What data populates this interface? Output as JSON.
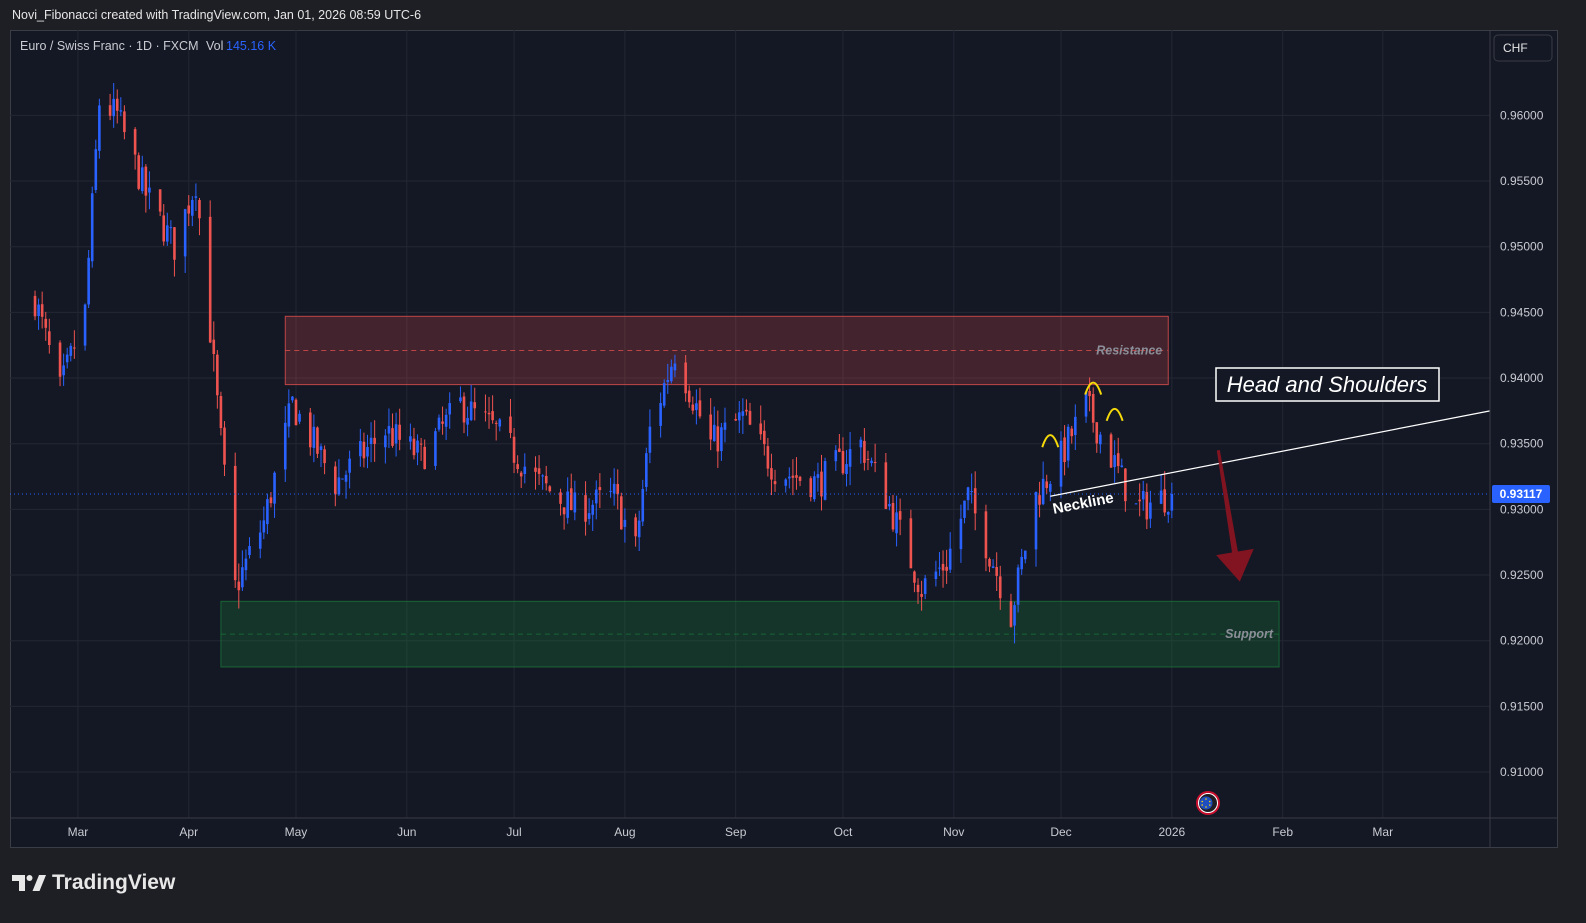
{
  "header": {
    "credit": "Novi_Fibonacci created with TradingView.com, Jan 01, 2026 08:59 UTC-6"
  },
  "legend": {
    "symbol": "Euro / Swiss Franc · 1D · FXCM",
    "vol_label": "Vol",
    "vol_value": "145.16 K"
  },
  "currency_button": "CHF",
  "footer": {
    "brand": "TradingView"
  },
  "colors": {
    "up": "#2962ff",
    "down": "#ef5350",
    "resistance_zone": "#ef5350",
    "support_zone": "#1b7a3a",
    "accent_label": "#2962ff",
    "pattern": "#f5d90a",
    "arrow": "#8e1320"
  },
  "chart_data": {
    "type": "candlestick",
    "symbol": "EURCHF",
    "timeframe": "1D",
    "y_axis": {
      "ticks": [
        "0.96000",
        "0.95500",
        "0.95000",
        "0.94500",
        "0.94000",
        "0.93500",
        "0.93000",
        "0.92500",
        "0.92000",
        "0.91500",
        "0.91000"
      ],
      "range": [
        0.9065,
        0.9665
      ]
    },
    "x_axis": {
      "ticks": [
        "Mar",
        "Apr",
        "May",
        "Jun",
        "Jul",
        "Aug",
        "Sep",
        "Oct",
        "Nov",
        "Dec",
        "2026",
        "Feb",
        "Mar"
      ]
    },
    "last_price": "0.93117",
    "price_path": [
      {
        "t": "2025-02-17",
        "close": 0.946
      },
      {
        "t": "2025-02-24",
        "close": 0.939
      },
      {
        "t": "2025-03-03",
        "close": 0.945
      },
      {
        "t": "2025-03-07",
        "close": 0.961
      },
      {
        "t": "2025-03-12",
        "close": 0.96
      },
      {
        "t": "2025-03-20",
        "close": 0.954
      },
      {
        "t": "2025-03-28",
        "close": 0.95
      },
      {
        "t": "2025-04-03",
        "close": 0.955
      },
      {
        "t": "2025-04-09",
        "close": 0.938
      },
      {
        "t": "2025-04-14",
        "close": 0.924
      },
      {
        "t": "2025-04-22",
        "close": 0.929
      },
      {
        "t": "2025-04-30",
        "close": 0.938
      },
      {
        "t": "2025-05-12",
        "close": 0.932
      },
      {
        "t": "2025-05-26",
        "close": 0.936
      },
      {
        "t": "2025-06-05",
        "close": 0.934
      },
      {
        "t": "2025-06-16",
        "close": 0.938
      },
      {
        "t": "2025-06-26",
        "close": 0.936
      },
      {
        "t": "2025-07-08",
        "close": 0.932
      },
      {
        "t": "2025-07-18",
        "close": 0.93
      },
      {
        "t": "2025-07-29",
        "close": 0.931
      },
      {
        "t": "2025-08-04",
        "close": 0.927
      },
      {
        "t": "2025-08-08",
        "close": 0.936
      },
      {
        "t": "2025-08-15",
        "close": 0.942
      },
      {
        "t": "2025-08-25",
        "close": 0.935
      },
      {
        "t": "2025-09-03",
        "close": 0.937
      },
      {
        "t": "2025-09-12",
        "close": 0.933
      },
      {
        "t": "2025-09-24",
        "close": 0.932
      },
      {
        "t": "2025-10-06",
        "close": 0.935
      },
      {
        "t": "2025-10-13",
        "close": 0.931
      },
      {
        "t": "2025-10-23",
        "close": 0.924
      },
      {
        "t": "2025-10-30",
        "close": 0.926
      },
      {
        "t": "2025-11-05",
        "close": 0.931
      },
      {
        "t": "2025-11-12",
        "close": 0.926
      },
      {
        "t": "2025-11-17",
        "close": 0.922
      },
      {
        "t": "2025-11-24",
        "close": 0.931
      },
      {
        "t": "2025-12-01",
        "close": 0.934
      },
      {
        "t": "2025-12-08",
        "close": 0.938
      },
      {
        "t": "2025-12-15",
        "close": 0.934
      },
      {
        "t": "2025-12-22",
        "close": 0.93
      },
      {
        "t": "2026-01-01",
        "close": 0.9312
      }
    ],
    "zones": [
      {
        "name": "Resistance",
        "from": "2025-04-28",
        "to": "2025-12-31",
        "low": 0.9395,
        "high": 0.9447
      },
      {
        "name": "Support",
        "from": "2025-04-10",
        "to": "2026-01-31",
        "low": 0.918,
        "high": 0.923
      }
    ],
    "annotations": [
      {
        "type": "label",
        "text": "Head and Shoulders"
      },
      {
        "type": "trendline",
        "text": "Neckline",
        "points": [
          {
            "t": "2025-11-28",
            "y": 0.931
          },
          {
            "t": "2026-03-31",
            "y": 0.9375
          }
        ]
      },
      {
        "type": "arcs",
        "text": "",
        "points": [
          {
            "t": "2025-11-28",
            "y": 0.9355
          },
          {
            "t": "2025-12-10",
            "y": 0.9395
          },
          {
            "t": "2025-12-16",
            "y": 0.9375
          }
        ]
      },
      {
        "type": "arrow",
        "direction": "down",
        "from": {
          "t": "2026-01-14",
          "y": 0.9345
        },
        "to": {
          "t": "2026-01-20",
          "y": 0.9245
        }
      }
    ]
  }
}
